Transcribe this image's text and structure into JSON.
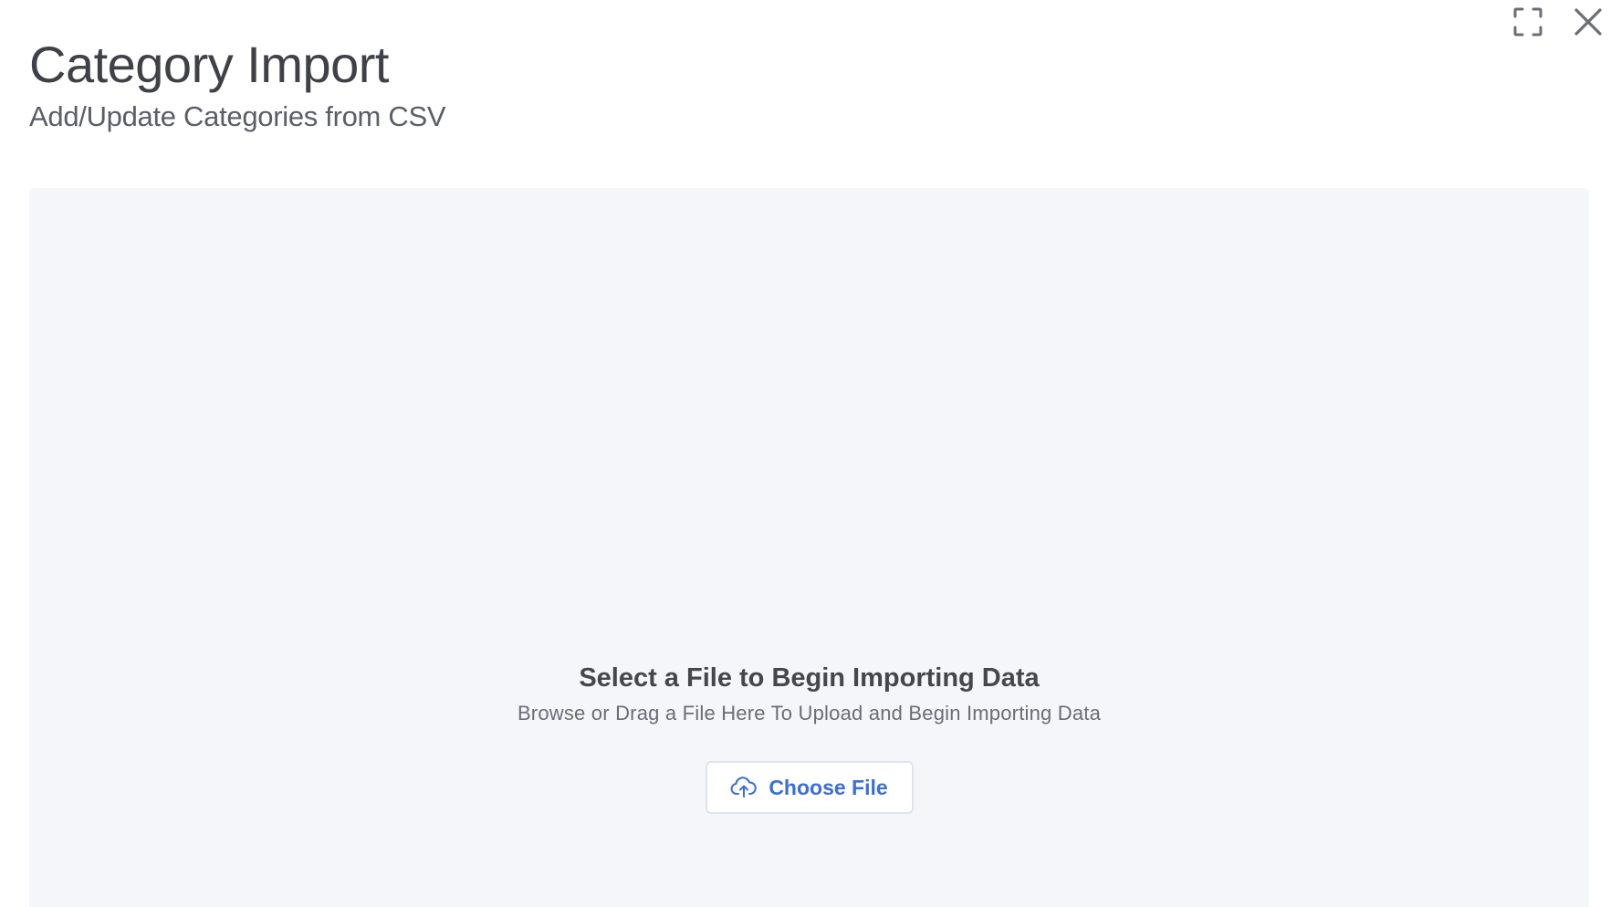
{
  "header": {
    "title": "Category Import",
    "subtitle": "Add/Update Categories from CSV"
  },
  "window_controls": {
    "fullscreen_icon": "expand-icon",
    "close_icon": "close-icon"
  },
  "dropzone": {
    "heading": "Select a File to Begin Importing Data",
    "subheading": "Browse or Drag a File Here To Upload and Begin Importing Data",
    "button_label": "Choose File",
    "button_icon": "cloud-upload-icon"
  },
  "colors": {
    "accent": "#3b6ed9",
    "dropzone_bg": "#f4f6fa",
    "title_text": "#3f4147"
  }
}
